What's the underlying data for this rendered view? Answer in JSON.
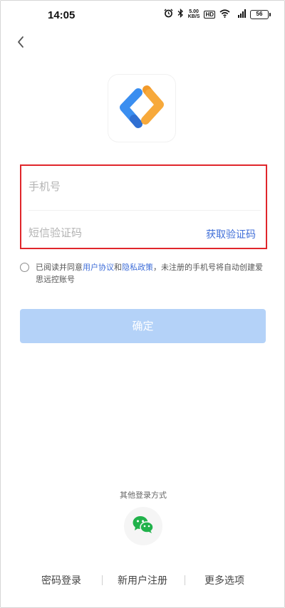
{
  "status_bar": {
    "time": "14:05",
    "alarm_icon": "alarm-icon",
    "bluetooth_icon": "bluetooth-icon",
    "speed_value": "5.00",
    "speed_unit": "KB/S",
    "hd_badge": "HD",
    "wifi_icon": "wifi-icon",
    "signal_label": "4G",
    "battery_level": "56"
  },
  "header": {
    "back_icon": "back-arrow-icon"
  },
  "logo": {
    "icon": "app-logo-icon",
    "colors": {
      "blue": "#3a8ef0",
      "orange": "#f7a93b"
    }
  },
  "form": {
    "phone_placeholder": "手机号",
    "phone_value": "",
    "sms_placeholder": "短信验证码",
    "sms_value": "",
    "get_code_label": "获取验证码",
    "highlight_color": "#e0262b"
  },
  "agreement": {
    "checked": false,
    "prefix": "已阅读并同意",
    "user_agreement": "用户协议",
    "and": "和",
    "privacy_policy": "隐私政策",
    "suffix": "，未注册的手机号将自动创建爱思远控账号"
  },
  "confirm_button": {
    "label": "确定",
    "enabled": false,
    "color": "#b4d2f8"
  },
  "other_login": {
    "title": "其他登录方式",
    "wechat_icon": "wechat-icon"
  },
  "bottom_nav": {
    "password_login": "密码登录",
    "register": "新用户注册",
    "more_options": "更多选项"
  },
  "accent_color": "#3f6ed8"
}
